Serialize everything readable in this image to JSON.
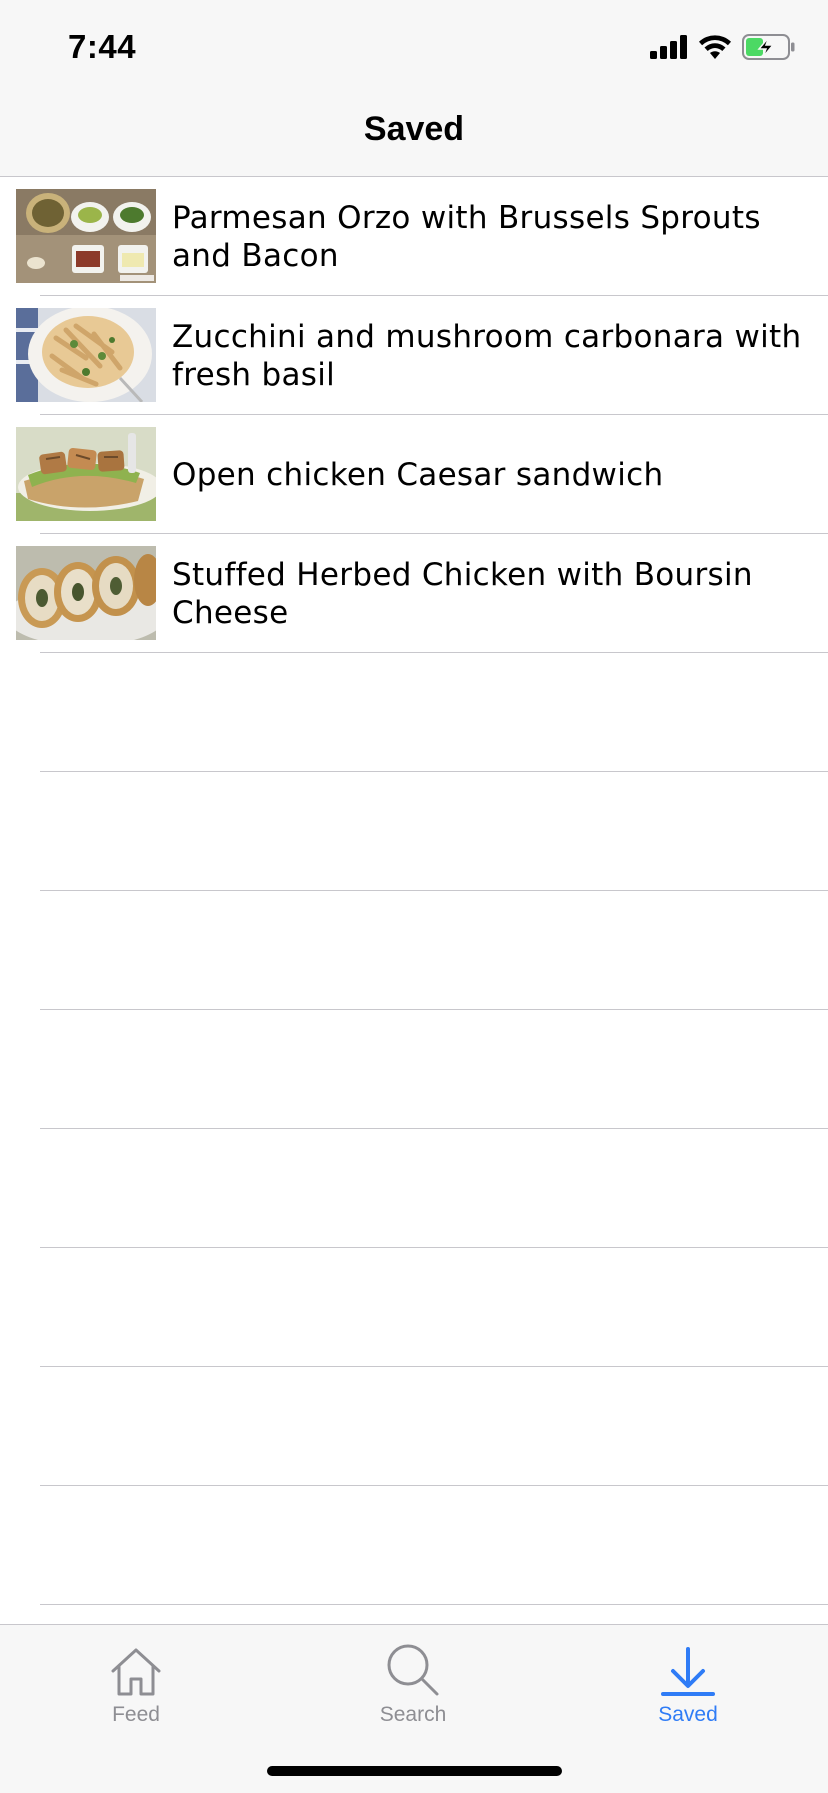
{
  "status": {
    "time": "7:44"
  },
  "nav": {
    "title": "Saved"
  },
  "recipes": [
    {
      "title": "Parmesan Orzo with Brussels Sprouts and Bacon",
      "thumb": "orzo-bowls-image"
    },
    {
      "title": "Zucchini and mushroom carbonara with fresh basil",
      "thumb": "pasta-plate-image"
    },
    {
      "title": "Open chicken Caesar sandwich",
      "thumb": "chicken-sandwich-image"
    },
    {
      "title": "Stuffed Herbed Chicken with Boursin Cheese",
      "thumb": "stuffed-chicken-image"
    }
  ],
  "tabs": [
    {
      "label": "Feed",
      "icon": "home-icon",
      "active": false
    },
    {
      "label": "Search",
      "icon": "magnifier-icon",
      "active": false
    },
    {
      "label": "Saved",
      "icon": "download-arrow-icon",
      "active": true
    }
  ],
  "colors": {
    "accent": "#2f7cf6",
    "inactive_tab": "#8e8e93",
    "bar_background": "#f7f7f7",
    "separator": "#c8c7cc"
  }
}
